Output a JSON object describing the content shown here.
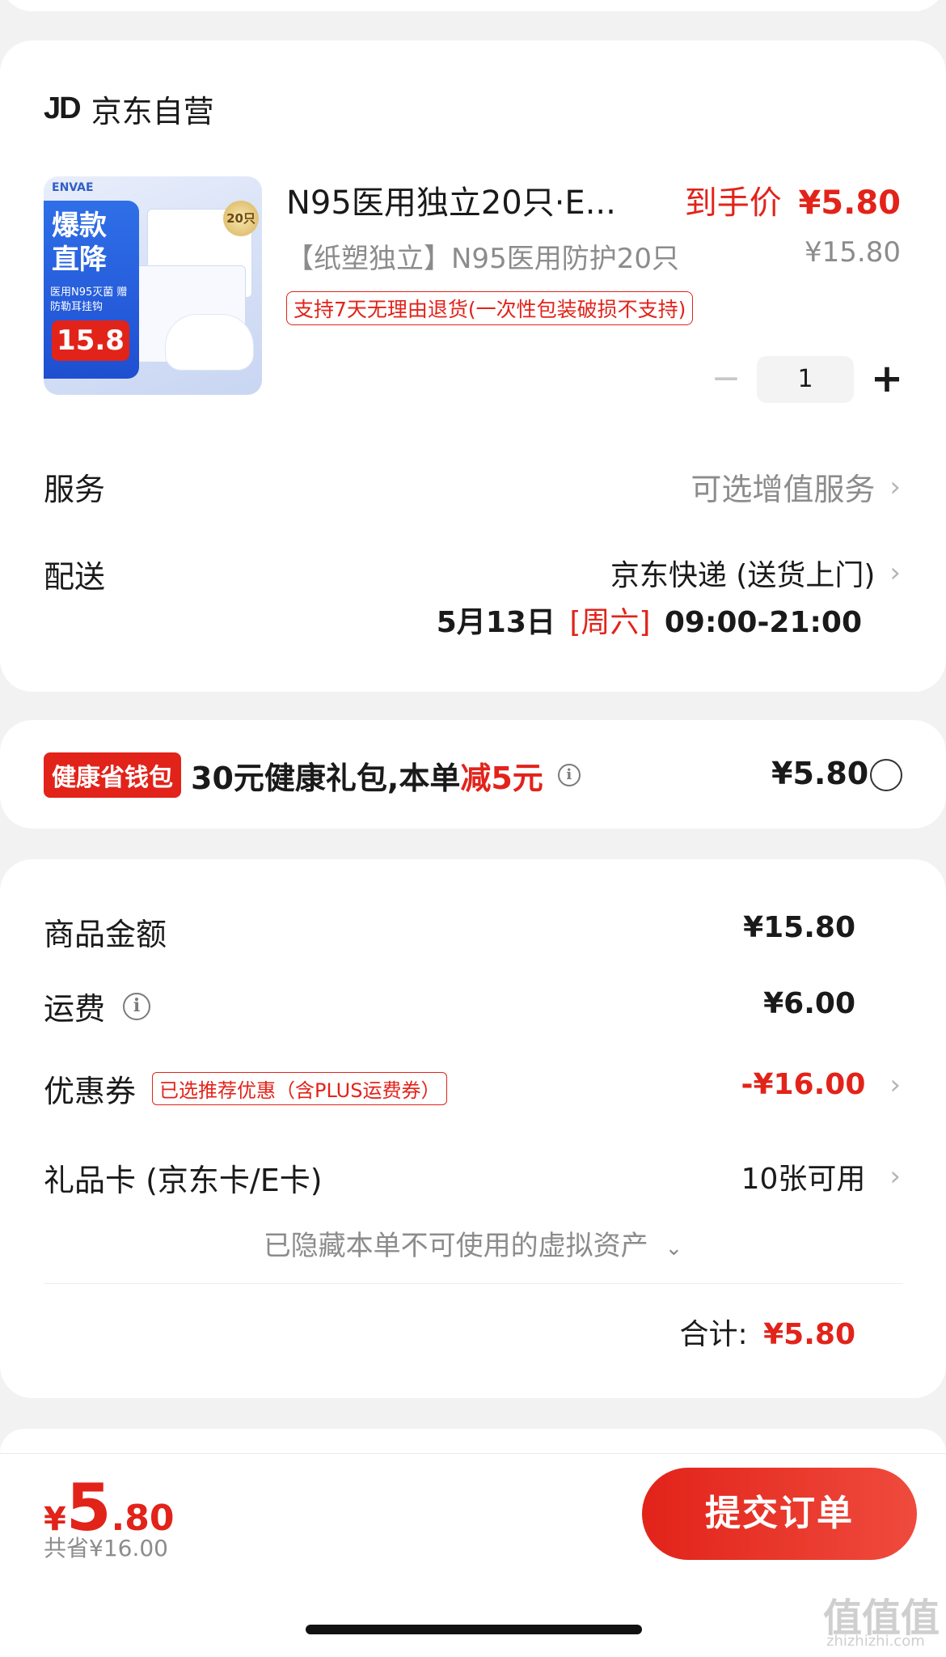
{
  "store": {
    "logo": "JD",
    "name": "京东自营"
  },
  "product": {
    "title": "N95医用独立20只·E...",
    "subtitle": "【纸塑独立】N95医用防护20只",
    "final_price_label": "到手价",
    "final_price": "¥5.80",
    "original_price": "¥15.80",
    "return_policy": "支持7天无理由退货(一次性包装破损不支持)",
    "quantity": "1",
    "image": {
      "brand": "ENVAE",
      "headline": "爆款直降",
      "promo": "医用N95灭菌 赠防勒耳挂钩",
      "price": "15.8",
      "badge": "20只"
    }
  },
  "service": {
    "label": "服务",
    "value": "可选增值服务"
  },
  "delivery": {
    "label": "配送",
    "method": "京东快递 (送货上门)",
    "date": "5月13日",
    "weekday": "[周六]",
    "time": "09:00-21:00"
  },
  "health": {
    "tag": "健康省钱包",
    "text": "30元健康礼包,本单",
    "discount": "减5元",
    "price": "¥5.80"
  },
  "summary": {
    "goods_label": "商品金额",
    "goods_value": "¥15.80",
    "shipping_label": "运费",
    "shipping_value": "¥6.00",
    "coupon_label": "优惠券",
    "coupon_tag": "已选推荐优惠（含PLUS运费券）",
    "coupon_value": "-¥16.00",
    "giftcard_label": "礼品卡 (京东卡/E卡)",
    "giftcard_value": "10张可用",
    "hidden_assets": "已隐藏本单不可使用的虚拟资产",
    "total_label": "合计:",
    "total_value": "¥5.80"
  },
  "bottom": {
    "currency": "¥",
    "price_int": "5",
    "price_dec": ".80",
    "saved": "共省¥16.00",
    "submit": "提交订单"
  },
  "watermark": {
    "glyphs": "值值值",
    "site": "zhizhizhi.com"
  },
  "colors": {
    "accent": "#e2231a",
    "background": "#f2f2f2"
  }
}
